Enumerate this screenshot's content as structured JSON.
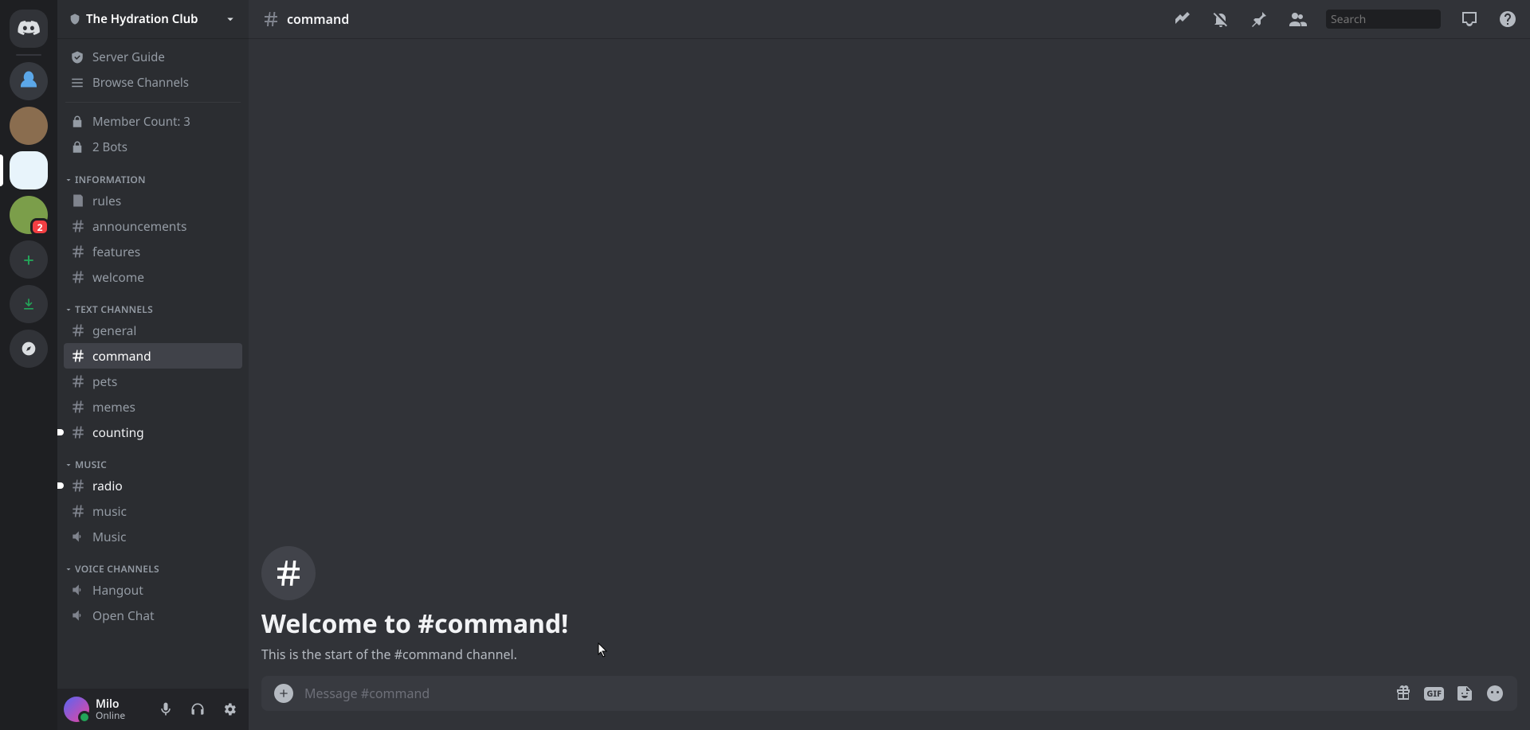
{
  "server": {
    "name": "The Hydration Club",
    "guide_label": "Server Guide",
    "browse_label": "Browse Channels",
    "member_count_label": "Member Count: 3",
    "bots_label": "2 Bots"
  },
  "servers_bar": {
    "badge_count": "2"
  },
  "categories": [
    {
      "name": "INFORMATION",
      "channels": [
        {
          "name": "rules",
          "type": "rules"
        },
        {
          "name": "announcements",
          "type": "text"
        },
        {
          "name": "features",
          "type": "text"
        },
        {
          "name": "welcome",
          "type": "text"
        }
      ]
    },
    {
      "name": "TEXT CHANNELS",
      "channels": [
        {
          "name": "general",
          "type": "text"
        },
        {
          "name": "command",
          "type": "text",
          "selected": true
        },
        {
          "name": "pets",
          "type": "text"
        },
        {
          "name": "memes",
          "type": "text"
        },
        {
          "name": "counting",
          "type": "text",
          "unread": true
        }
      ]
    },
    {
      "name": "MUSIC",
      "channels": [
        {
          "name": "radio",
          "type": "text",
          "unread": true
        },
        {
          "name": "music",
          "type": "text"
        },
        {
          "name": "Music",
          "type": "voice"
        }
      ]
    },
    {
      "name": "VOICE CHANNELS",
      "channels": [
        {
          "name": "Hangout",
          "type": "voice"
        },
        {
          "name": "Open Chat",
          "type": "voice"
        }
      ]
    }
  ],
  "user": {
    "name": "Milo",
    "status": "Online"
  },
  "channel_header": {
    "name": "command"
  },
  "search": {
    "placeholder": "Search"
  },
  "welcome": {
    "title": "Welcome to #command!",
    "subtitle": "This is the start of the #command channel."
  },
  "composer": {
    "placeholder": "Message #command",
    "gif_label": "GIF"
  }
}
